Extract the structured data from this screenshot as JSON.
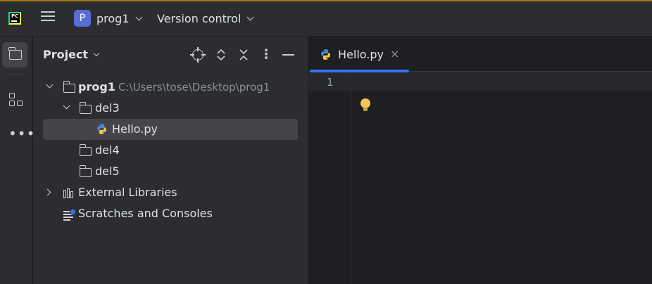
{
  "titlebar": {
    "app_icon": "pycharm-logo-icon",
    "app_icon_text": "PC",
    "menu_icon": "hamburger-icon",
    "project_badge": "P",
    "project_name": "prog1",
    "vcs_label": "Version control",
    "colors": {
      "background": "#2b2d30",
      "badge": "#5a6dd6"
    }
  },
  "toolstrip": {
    "items": [
      {
        "icon": "folder-icon",
        "active": true
      },
      {
        "icon": "structure-icon",
        "active": false
      },
      {
        "icon": "more-dots-icon",
        "active": false
      }
    ]
  },
  "project_panel": {
    "title": "Project",
    "toolbar_icons": [
      "locate-target-icon",
      "expand-all-icon",
      "collapse-all-icon",
      "kebab-menu-icon",
      "minimize-icon"
    ],
    "tree": [
      {
        "label": "prog1",
        "path": "C:\\Users\\tose\\Desktop\\prog1",
        "type": "folder",
        "expanded": true
      },
      {
        "label": "del3",
        "type": "folder",
        "expanded": true
      },
      {
        "label": "Hello.py",
        "type": "python-file",
        "selected": true
      },
      {
        "label": "del4",
        "type": "folder"
      },
      {
        "label": "del5",
        "type": "folder"
      },
      {
        "label": "External Libraries",
        "type": "libraries",
        "expanded": false
      },
      {
        "label": "Scratches and Consoles",
        "type": "scratches"
      }
    ]
  },
  "editor": {
    "tabs": [
      {
        "label": "Hello.py",
        "icon": "python-file-icon",
        "close": "×",
        "active": true
      }
    ],
    "line_numbers": [
      "1"
    ],
    "hint_icon": "lightbulb-icon",
    "colors": {
      "accent": "#3574f0",
      "background": "#1e1f22",
      "bulb": "#f2c55c"
    }
  }
}
